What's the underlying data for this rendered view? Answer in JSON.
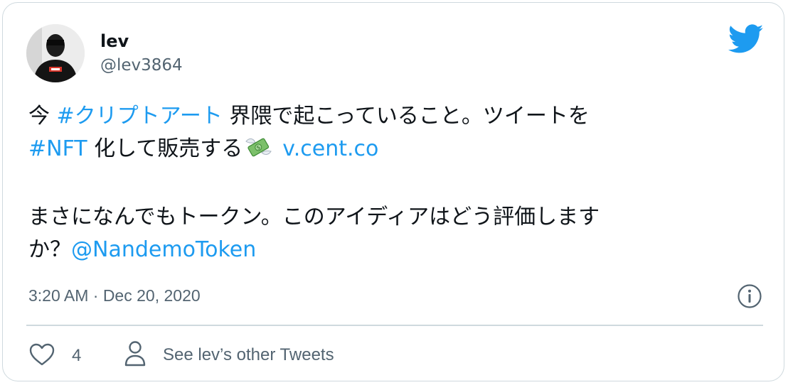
{
  "author": {
    "name": "lev",
    "handle": "@lev3864",
    "avatar_icon": "avatar-photo"
  },
  "brand": {
    "icon": "twitter-bird-icon",
    "color": "#1d9bf0"
  },
  "tweet": {
    "line1": {
      "pre": "今 ",
      "hashtag": "#クリプトアート",
      "post": " 界隈で起こっていること。ツイートを"
    },
    "line2": {
      "hashtag": "#NFT",
      "text": " 化して販売する",
      "emoji_icon": "money-with-wings-icon",
      "link": "v.cent.co"
    },
    "line3": {
      "text": "まさになんでもトークン。このアイディアはどう評価しますか？",
      "line_a": "まさになんでもトークン。このアイディアはどう評価します",
      "line_b_pre": "か？",
      "mention": "@NandemoToken"
    }
  },
  "meta": {
    "timestamp": "3:20 AM · Dec 20, 2020",
    "info_icon": "info-icon"
  },
  "actions": {
    "like_icon": "heart-icon",
    "like_count": "4",
    "profile_icon": "person-icon",
    "profile_label": "See lev’s other Tweets"
  },
  "colors": {
    "text": "#0f1419",
    "secondary": "#536471",
    "link": "#1d9bf0",
    "border": "#cfd9de"
  }
}
